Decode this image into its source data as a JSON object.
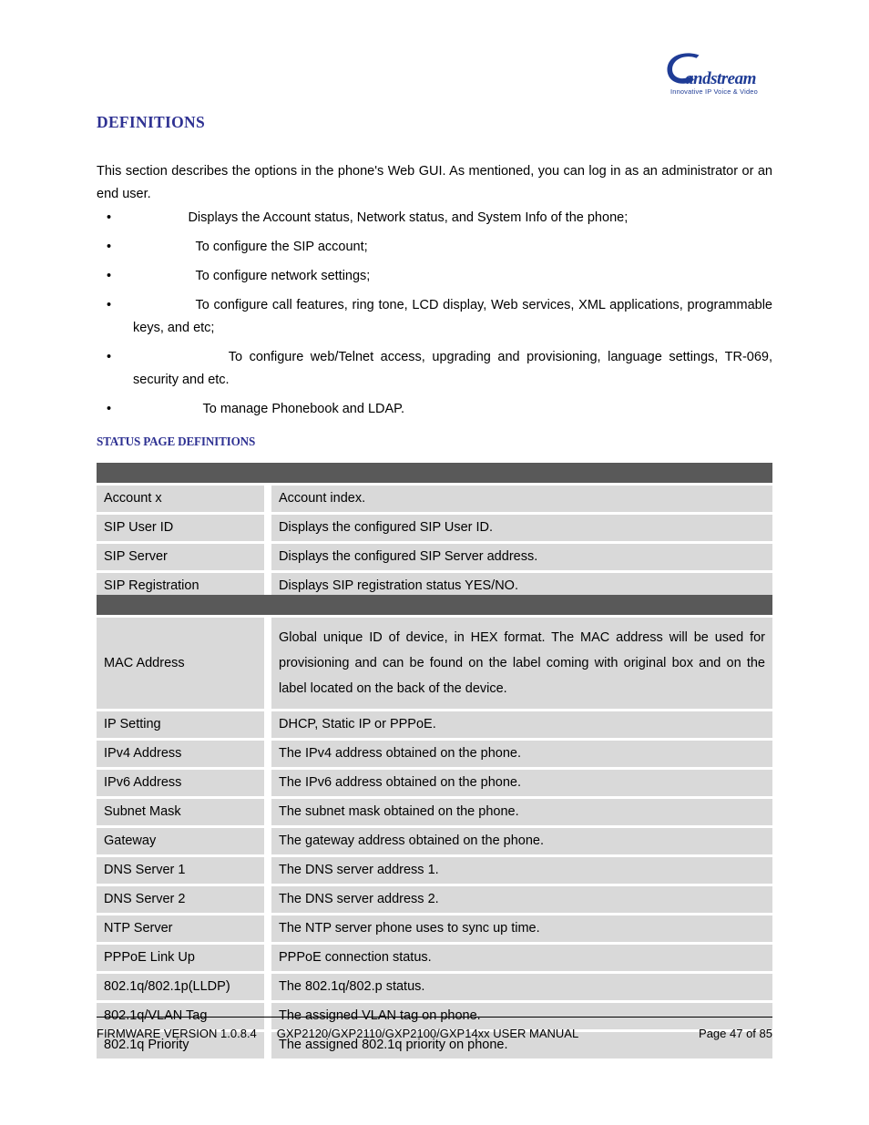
{
  "logo": {
    "brand": "Grandstream",
    "tagline": "Innovative IP Voice & Video",
    "brand_color": "#1F3C96"
  },
  "headings": {
    "definitions": "DEFINITIONS",
    "status_page_definitions": "STATUS PAGE DEFINITIONS",
    "heading_color": "#2E3192"
  },
  "intro": {
    "paragraph": "This section describes the options in the phone's Web GUI. As mentioned, you can log in as an administrator or an end user."
  },
  "bullets": [
    {
      "marker": "•",
      "indent": "               ",
      "text": "Displays the Account status, Network status, and System Info of the phone;"
    },
    {
      "marker": "•",
      "indent": "                 ",
      "text": "To configure the SIP account;"
    },
    {
      "marker": "•",
      "indent": "                 ",
      "text": "To configure network settings;"
    },
    {
      "marker": "•",
      "indent": "                 ",
      "text": "To configure call features, ring tone, LCD display, Web services, XML applications, programmable keys, and etc;"
    },
    {
      "marker": "•",
      "indent": "                          ",
      "text": "To configure web/Telnet access, upgrading and provisioning, language settings, TR-069, security and etc."
    },
    {
      "marker": "•",
      "indent": "                   ",
      "text": "To manage Phonebook and LDAP."
    }
  ],
  "tables": {
    "colors": {
      "band": "#595959",
      "cell": "#D9D9D9",
      "gap": "#FFFFFF"
    },
    "account_table": {
      "band_label": "",
      "rows": [
        {
          "key": "Account x",
          "value": "Account index."
        },
        {
          "key": "SIP User ID",
          "value": "Displays the configured SIP User ID."
        },
        {
          "key": "SIP Server",
          "value": "Displays the configured SIP Server address."
        },
        {
          "key": "SIP Registration",
          "value": "Displays SIP registration status YES/NO."
        }
      ]
    },
    "network_table": {
      "band_label": "",
      "rows": [
        {
          "key": "MAC Address",
          "value": "Global unique ID of device, in HEX format. The MAC address will be used for provisioning and can be found on the label coming with original box and on the label located on the back of the device.",
          "tall": true
        },
        {
          "key": "IP Setting",
          "value": "DHCP, Static IP or PPPoE."
        },
        {
          "key": "IPv4 Address",
          "value": "The IPv4 address obtained on the phone."
        },
        {
          "key": "IPv6 Address",
          "value": "The IPv6 address obtained on the phone."
        },
        {
          "key": "Subnet Mask",
          "value": "The subnet mask obtained on the phone."
        },
        {
          "key": "Gateway",
          "value": "The gateway address obtained on the phone."
        },
        {
          "key": "DNS Server 1",
          "value": "The DNS server address 1."
        },
        {
          "key": "DNS Server 2",
          "value": "The DNS server address 2."
        },
        {
          "key": "NTP Server",
          "value": "The NTP server phone uses to sync up time."
        },
        {
          "key": "PPPoE Link Up",
          "value": "PPPoE connection status."
        },
        {
          "key": "802.1q/802.1p(LLDP)",
          "value": "The 802.1q/802.p status."
        },
        {
          "key": "802.1q/VLAN Tag",
          "value": "The assigned VLAN tag on phone."
        },
        {
          "key": "802.1q Priority",
          "value": "The assigned 802.1q priority on phone."
        }
      ]
    }
  },
  "footer": {
    "firmware": "FIRMWARE VERSION 1.0.8.4",
    "manual": "GXP2120/GXP2110/GXP2100/GXP14xx USER MANUAL",
    "page": "Page 47 of 85"
  }
}
